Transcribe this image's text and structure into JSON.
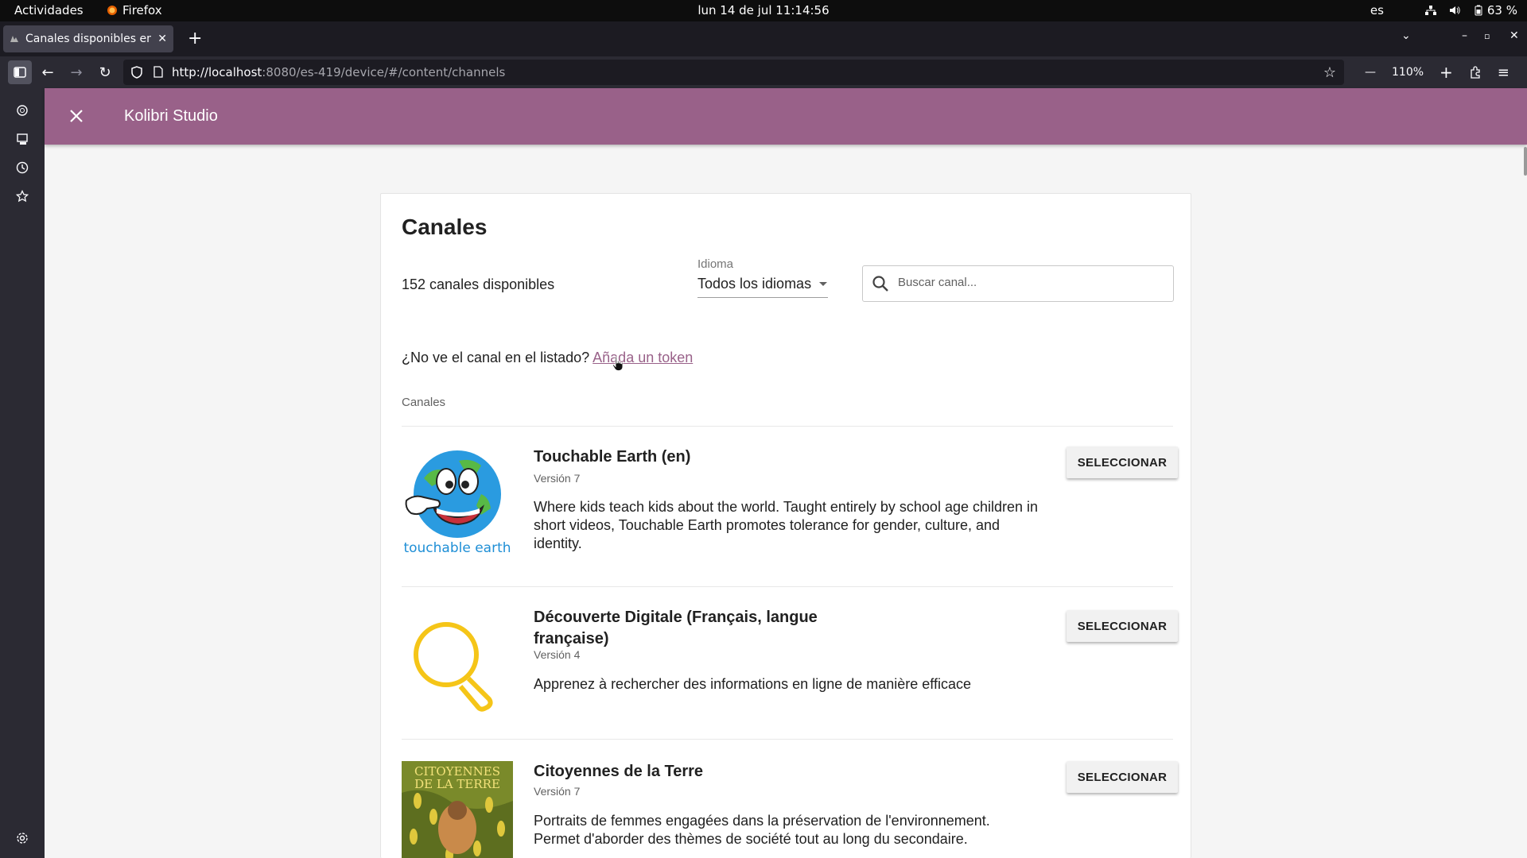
{
  "system_bar": {
    "activities": "Actividades",
    "app_name": "Firefox",
    "clock": "lun 14 de jul  11:14:56",
    "lang": "es",
    "battery": "63 %"
  },
  "browser": {
    "tab_title": "Canales disponibles en Kolibri",
    "url_host": "http://localhost",
    "url_path": ":8080/es-419/device/#/content/channels",
    "zoom": "110%"
  },
  "app_header": {
    "title": "Kolibri Studio"
  },
  "page": {
    "heading": "Canales",
    "count_text": "152 canales disponibles",
    "language_label": "Idioma",
    "language_value": "Todos los idiomas",
    "search_placeholder": "Buscar canal...",
    "token_prompt": "¿No ve el canal en el listado?",
    "token_link": "Añada un token",
    "section_label": "Canales",
    "select_label": "SELECCIONAR"
  },
  "channels": [
    {
      "title": "Touchable Earth (en)",
      "version": "Versión 7",
      "description": "Where kids teach kids about the world. Taught entirely by school age children in short videos, Touchable Earth promotes tolerance for gender, culture, and identity.",
      "thumb_text": "touchable earth"
    },
    {
      "title": "Découverte Digitale (Français, langue française)",
      "version": "Versión 4",
      "description": "Apprenez à rechercher des informations en ligne de manière efficace"
    },
    {
      "title": "Citoyennes de la Terre",
      "version": "Versión 7",
      "description": "Portraits de femmes engagées dans la préservation de l'environnement. Permet d'aborder des thèmes de société tout au long du secondaire.",
      "thumb_text_1": "CITOYENNES",
      "thumb_text_2": "DE LA TERRE"
    }
  ],
  "colors": {
    "brand": "#996189",
    "magnifier": "#f5c518"
  }
}
